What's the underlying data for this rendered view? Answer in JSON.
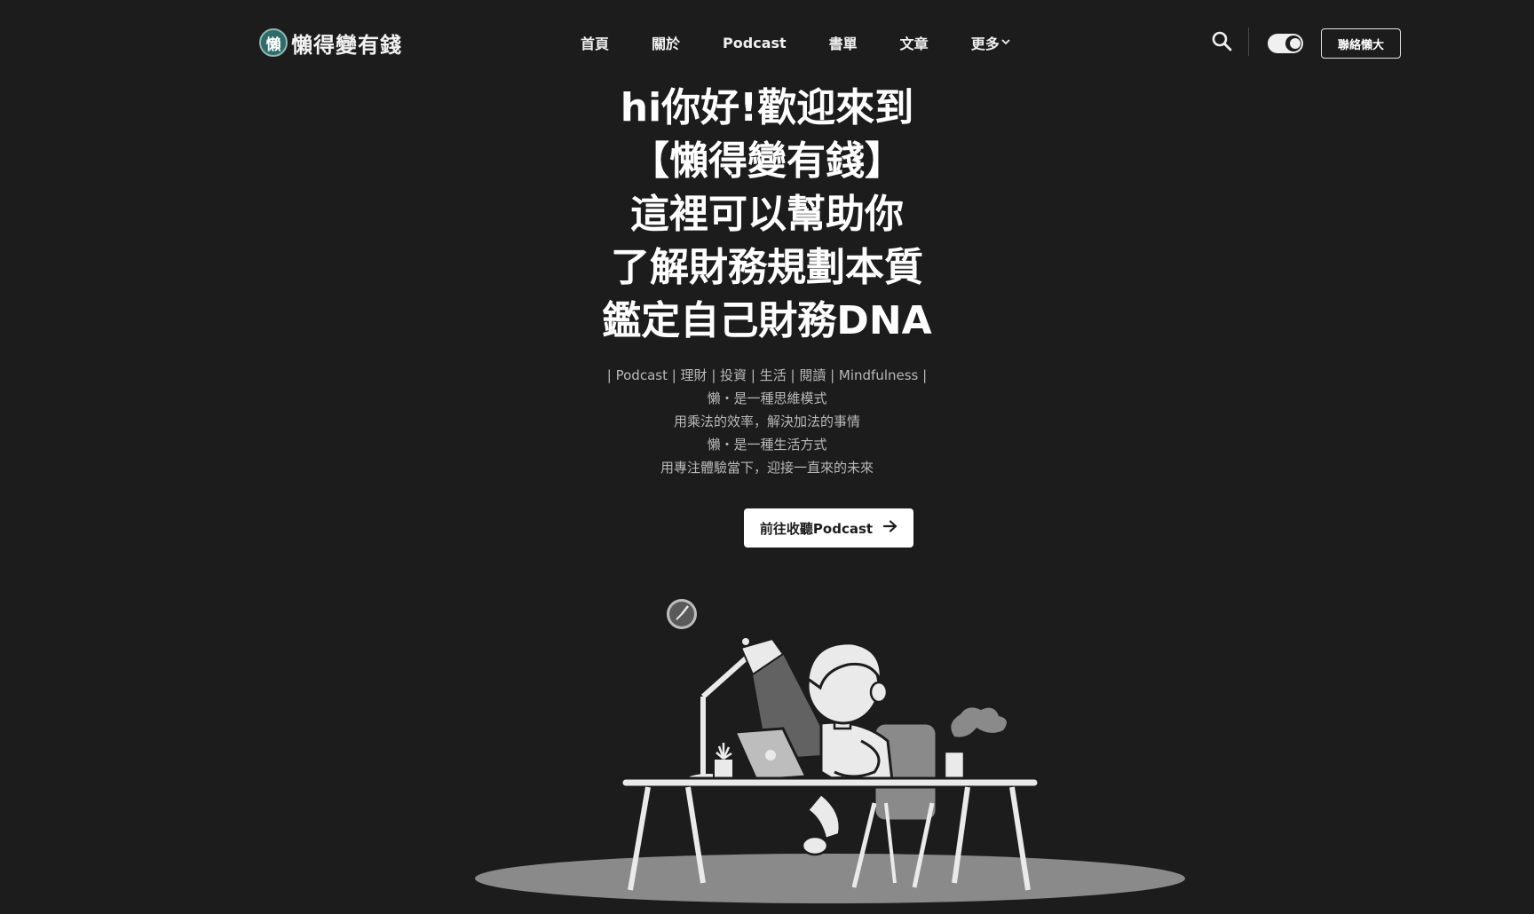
{
  "site": {
    "logo_badge": "懶",
    "logo_text": "懶得變有錢"
  },
  "nav": {
    "items": [
      {
        "label": "首頁"
      },
      {
        "label": "關於"
      },
      {
        "label": "Podcast"
      },
      {
        "label": "書單"
      },
      {
        "label": "文章"
      },
      {
        "label": "更多"
      }
    ]
  },
  "header": {
    "contact_label": "聯絡懶大"
  },
  "hero": {
    "title_lines": [
      "hi你好!歡迎來到",
      "【懶得變有錢】",
      "這裡可以幫助你",
      "了解財務規劃本質",
      "鑑定自己財務DNA"
    ],
    "subtitle_lines": [
      "| Podcast | 理財 | 投資 | 生活 | 閱讀 | Mindfulness |",
      "懶・是一種思維模式",
      "用乘法的效率，解決加法的事情",
      "懶・是一種生活方式",
      "用專注體驗當下，迎接一直來的未來"
    ],
    "cta_label": "前往收聽Podcast"
  },
  "icons": {
    "search": "search-icon",
    "theme_toggle": "moon-icon",
    "dropdown": "chevron-down-icon",
    "cta_arrow": "arrow-right-icon"
  },
  "colors": {
    "background": "#1c1c1c",
    "text": "#ffffff",
    "muted_text": "#b9b9b9",
    "logo_teal": "#2f6b6b"
  }
}
